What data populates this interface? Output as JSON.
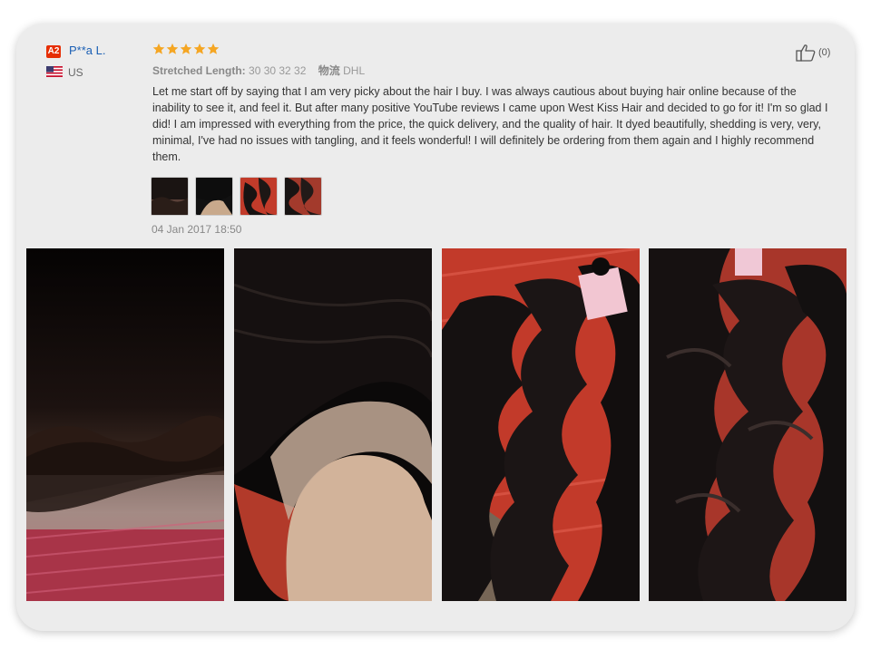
{
  "reviewer": {
    "level_badge": "A2",
    "name": "P**a L.",
    "country_code": "US",
    "flag_icon": "us-flag-icon"
  },
  "rating": {
    "stars": 5,
    "out_of": 5,
    "color": "#f5a623"
  },
  "meta": {
    "stretched_length_label": "Stretched Length:",
    "stretched_length_value": "30 30 32 32",
    "shipping_label": "物流",
    "shipping_value": "DHL"
  },
  "review": {
    "text": "Let me start off by saying that I am very picky about the hair I buy. I was always cautious about buying hair online because of the inability to see it, and feel it. But after many positive YouTube reviews I came upon West Kiss Hair and decided to go for it! I'm so glad I did! I am impressed with everything from the price, the quick delivery, and the quality of hair. It dyed beautifully, shedding is very, very, minimal, I've had no issues with tangling, and it feels wonderful! I will definitely be ordering from them again and I highly recommend them.",
    "date": "04 Jan 2017 18:50"
  },
  "helpful": {
    "icon": "thumbs-up-icon",
    "count_text": "(0)"
  },
  "thumbnails": [
    "lace-frontal-thumbnail",
    "hairline-thumbnail",
    "bundles-thumbnail",
    "body-wave-thumbnail"
  ],
  "photos": [
    "lace-frontal-photo",
    "hairline-closeup-photo",
    "hair-bundles-photo",
    "body-wave-hair-photo"
  ],
  "colors": {
    "card_bg": "#ececec",
    "username": "#1a5fb4",
    "badge": "#e62e04"
  }
}
